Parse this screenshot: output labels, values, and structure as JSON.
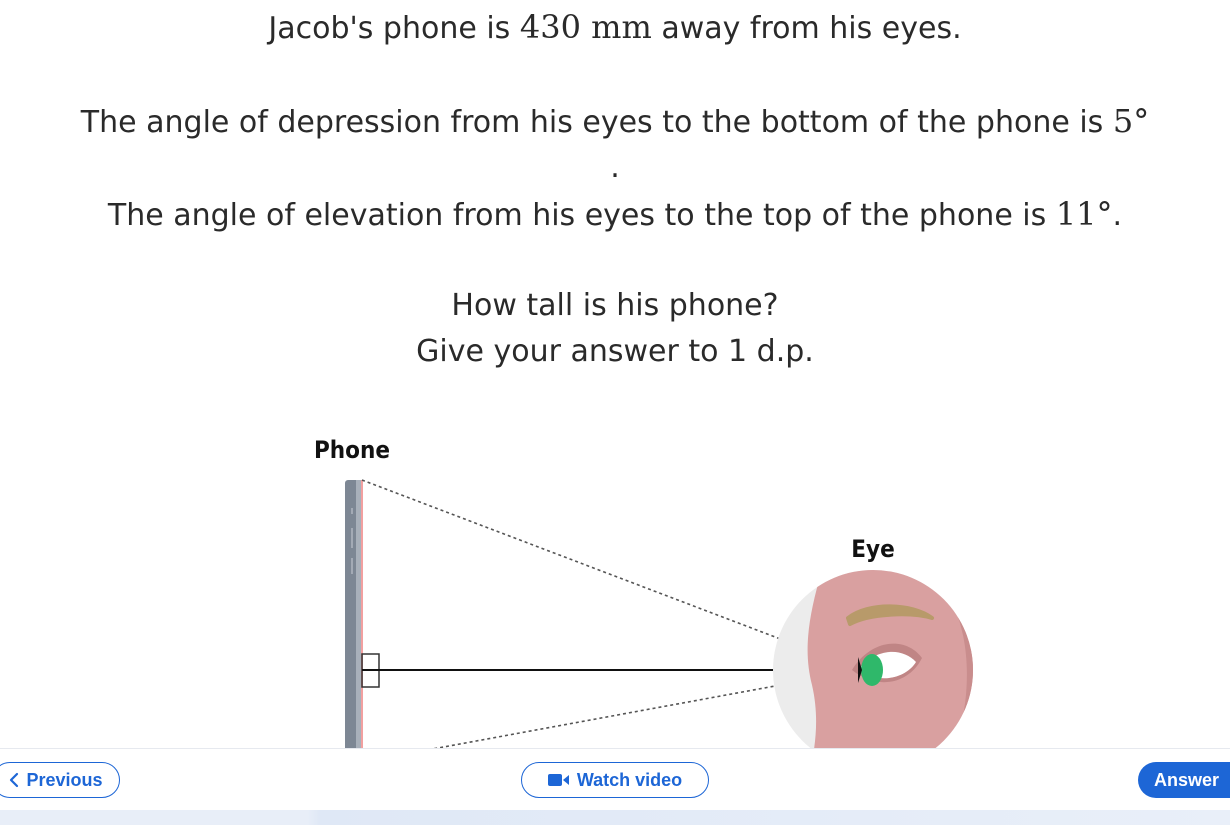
{
  "question": {
    "line1_pre": "Jacob's phone is ",
    "line1_math": "430 mm",
    "line1_post": " away from his eyes.",
    "line2_pre": "The angle of depression from his eyes to the bottom of the phone is ",
    "line2_math": "5°",
    "line2_dot": ".",
    "line3_pre": "The angle of elevation from his eyes to the top of the phone is ",
    "line3_math": "11°",
    "line3_post": ".",
    "line4": "How tall is his phone?",
    "line5": "Give your answer to 1 d.p."
  },
  "diagram": {
    "phone_label": "Phone",
    "eye_label": "Eye",
    "iris_color": "#2fb86a",
    "skin_color": "#d9a0a0",
    "brow_color": "#b89a6a"
  },
  "footer": {
    "previous_label": "Previous",
    "watch_label": "Watch video",
    "answer_label": "Answer",
    "accent_color": "#1d66d6"
  }
}
